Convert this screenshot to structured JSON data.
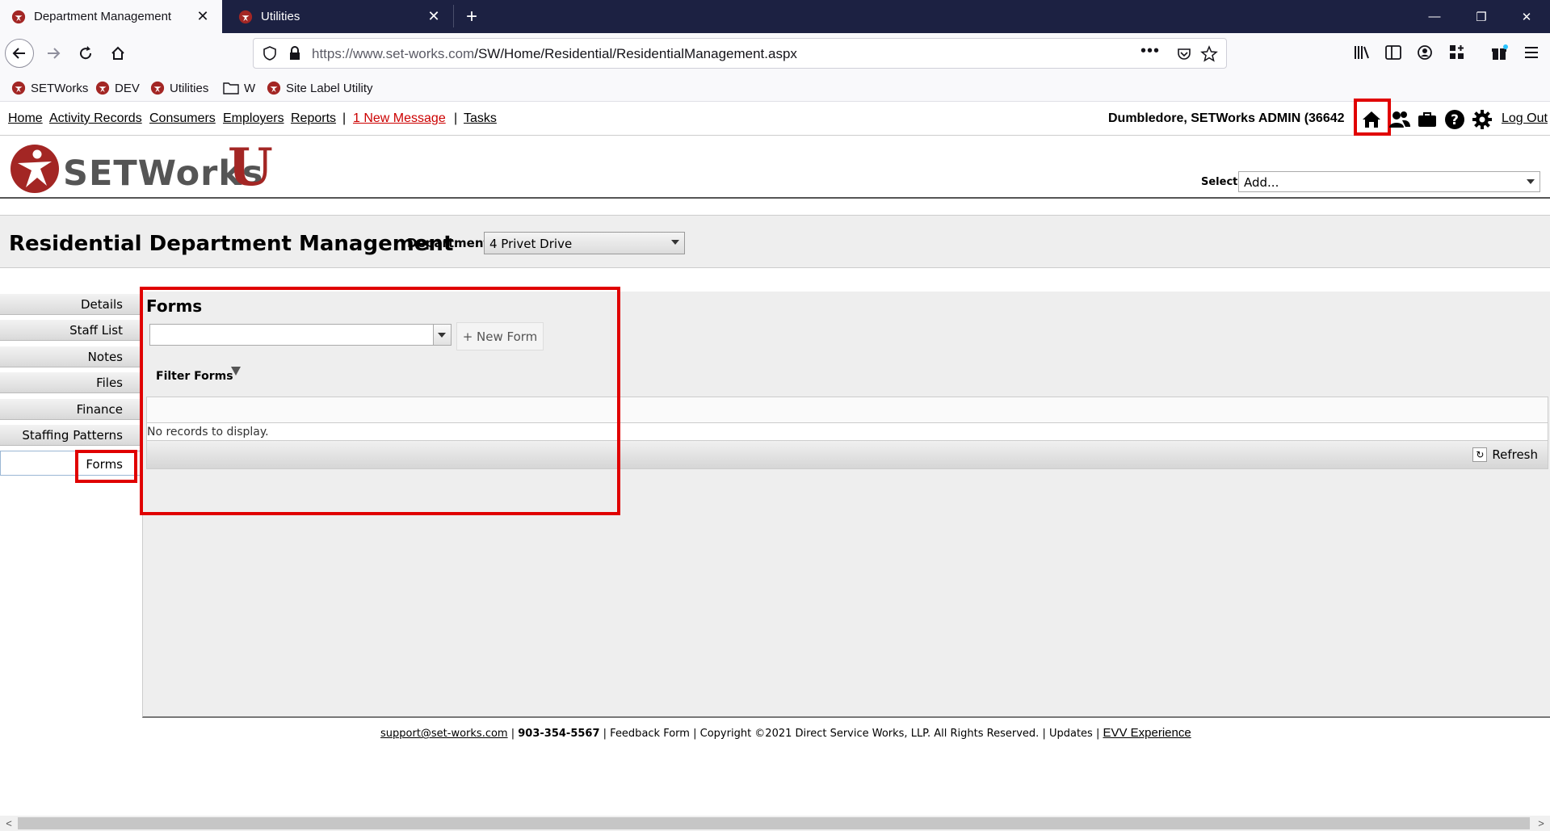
{
  "browser": {
    "tabs": [
      {
        "title": "Department Management",
        "active": true
      },
      {
        "title": "Utilities",
        "active": false
      }
    ],
    "url_domain": "https://www.set-works.com",
    "url_path": "/SW/Home/Residential/ResidentialManagement.aspx",
    "url_more": "•••",
    "bookmarks": [
      "SETWorks",
      "DEV",
      "Utilities",
      "W",
      "Site Label Utility"
    ]
  },
  "topnav": {
    "links": [
      "Home",
      "Activity Records",
      "Consumers",
      "Employers",
      "Reports"
    ],
    "message_link": "1 New Message",
    "tasks_link": "Tasks",
    "separator": "|",
    "user": "Dumbledore, SETWorks ADMIN  (36642",
    "logout": "Log Out"
  },
  "logo": {
    "wordmark": "SETWorks",
    "u": "U"
  },
  "select": {
    "label": "Select:",
    "value": "Add..."
  },
  "page": {
    "title": "Residential Department Management",
    "department_label": "Department:",
    "department_value": "4 Privet Drive"
  },
  "side_tabs": [
    "Details",
    "Staff List",
    "Notes",
    "Files",
    "Finance",
    "Staffing Patterns",
    "Forms"
  ],
  "active_side_tab": "Forms",
  "forms": {
    "heading": "Forms",
    "new_form_label": "+ New Form",
    "filter_label": "Filter Forms",
    "empty_message": "No records to display.",
    "refresh_label": "Refresh"
  },
  "footer": {
    "email": "support@set-works.com",
    "phone": "903-354-5567",
    "feedback": "Feedback Form",
    "copyright": "Copyright ©2021 Direct Service Works, LLP. All Rights Reserved.",
    "updates": "Updates",
    "evv": "EVV Experience"
  },
  "colors": {
    "brand_red": "#a32624",
    "highlight_red": "#e00000",
    "tabbar": "#1c2142"
  }
}
